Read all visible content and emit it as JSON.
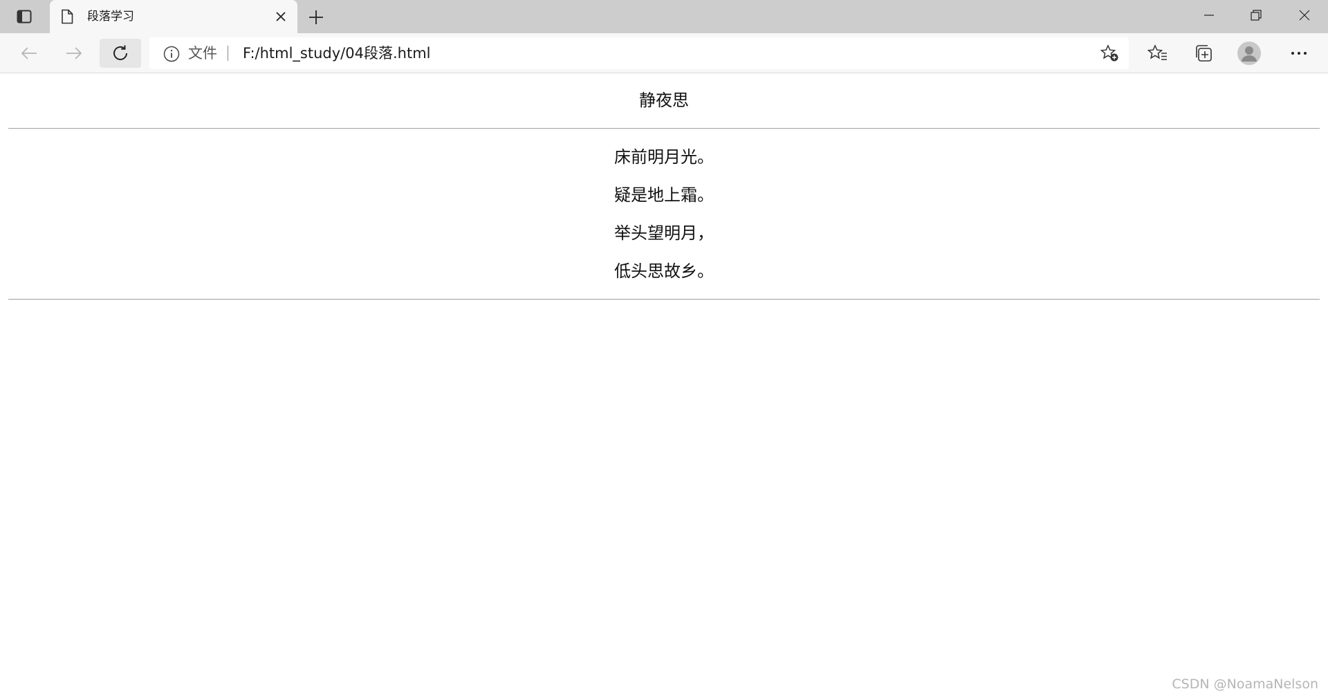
{
  "browser": {
    "tab": {
      "title": "段落学习"
    },
    "address_bar": {
      "scheme_label": "文件",
      "url": "F:/html_study/04段落.html"
    },
    "icons": {
      "tab_actions": "vertical-tabs-icon",
      "tab_page": "document-icon",
      "tab_close": "close-icon",
      "new_tab": "plus-icon",
      "back": "arrow-left-icon",
      "forward": "arrow-right-icon",
      "refresh": "refresh-icon",
      "info": "info-icon",
      "add_favorite": "star-add-icon",
      "favorites": "favorites-icon",
      "collections": "collections-icon",
      "profile": "avatar-icon",
      "more": "ellipsis-icon",
      "minimize": "minimize-icon",
      "maximize": "restore-icon",
      "close_window": "close-icon"
    }
  },
  "page": {
    "title": "静夜思",
    "lines": [
      "床前明月光。",
      "疑是地上霜。",
      "举头望明月，",
      "低头思故乡。"
    ]
  },
  "watermark": "CSDN @NoamaNelson"
}
